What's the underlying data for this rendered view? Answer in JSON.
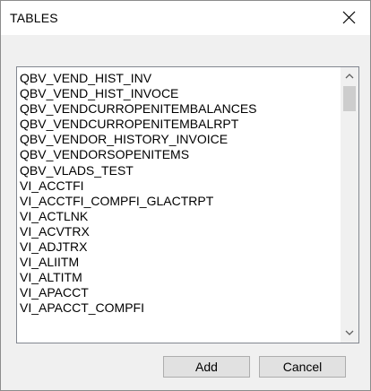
{
  "window": {
    "title": "TABLES"
  },
  "close_icon": "close-icon",
  "list": {
    "items": [
      "QBV_VEND_HIST_INV",
      "QBV_VEND_HIST_INVOCE",
      "QBV_VENDCURROPENITEMBALANCES",
      "QBV_VENDCURROPENITEMBALRPT",
      "QBV_VENDOR_HISTORY_INVOICE",
      "QBV_VENDORSOPENITEMS",
      "QBV_VLADS_TEST",
      "VI_ACCTFI",
      "VI_ACCTFI_COMPFI_GLACTRPT",
      "VI_ACTLNK",
      "VI_ACVTRX",
      "VI_ADJTRX",
      "VI_ALIITM",
      "VI_ALTITM",
      "VI_APACCT",
      "VI_APACCT_COMPFI"
    ]
  },
  "buttons": {
    "add_label": "Add",
    "cancel_label": "Cancel"
  },
  "colors": {
    "dialog_background": "#f0f0f0",
    "titlebar_background": "#ffffff",
    "button_background": "#e1e1e1",
    "scroll_thumb": "#cdcdcd"
  }
}
